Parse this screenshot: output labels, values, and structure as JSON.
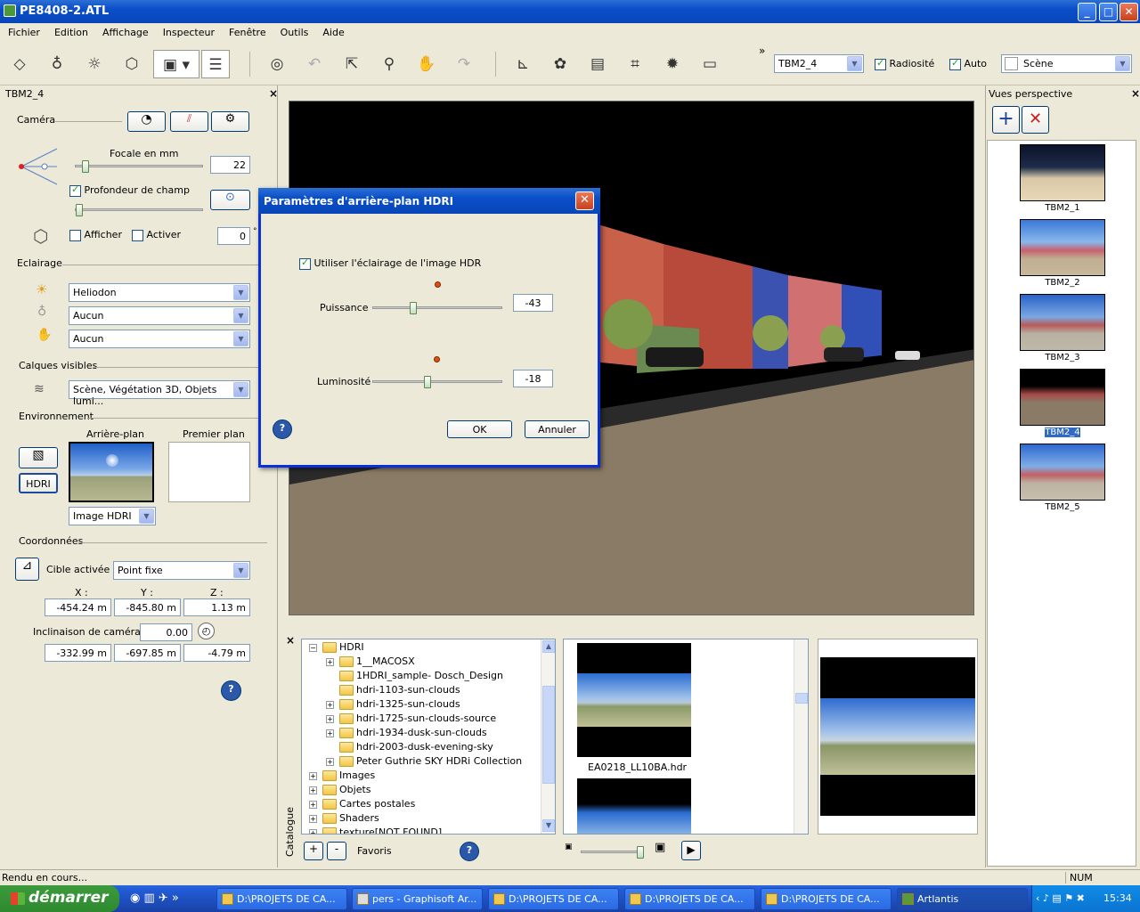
{
  "window": {
    "title": "PE8408-2.ATL"
  },
  "menu": [
    "Fichier",
    "Edition",
    "Affichage",
    "Inspecteur",
    "Fenêtre",
    "Outils",
    "Aide"
  ],
  "toolbar": {
    "view_select": "TBM2_4",
    "radiosity_label": "Radiosité",
    "auto_label": "Auto",
    "scene_select": "Scène",
    "overflow": "»"
  },
  "left_panel": {
    "title": "TBM2_4",
    "camera_label": "Caméra",
    "focal_label": "Focale en mm",
    "focal_value": "22",
    "focal_level": 0.05,
    "dof_label": "Profondeur de champ",
    "dof_level": 0.0,
    "show_label": "Afficher",
    "activate_label": "Activer",
    "angle_value": "0",
    "angle_unit": "°",
    "lighting_label": "Eclairage",
    "light1": "Heliodon",
    "light2": "Aucun",
    "light3": "Aucun",
    "layers_label": "Calques visibles",
    "layers_value": "Scène, Végétation 3D, Objets lumi...",
    "env_label": "Environnement",
    "background_label": "Arrière-plan",
    "foreground_label": "Premier plan",
    "hdri_button": "HDRI",
    "bg_type": "Image HDRI",
    "coords_label": "Coordonnées",
    "target_label": "Cible activée :",
    "target_value": "Point fixe",
    "x_label": "X :",
    "y_label": "Y :",
    "z_label": "Z :",
    "x1": "-454.24 m",
    "y1": "-845.80 m",
    "z1": "1.13 m",
    "tilt_label": "Inclinaison de caméra :",
    "tilt_value": "0.00",
    "x2": "-332.99 m",
    "y2": "-697.85 m",
    "z2": "-4.79 m",
    "help": "?"
  },
  "right_panel": {
    "title": "Vues perspective",
    "views": [
      "TBM2_1",
      "TBM2_2",
      "TBM2_3",
      "TBM2_4",
      "TBM2_5"
    ],
    "selected": "TBM2_4"
  },
  "dialog": {
    "title": "Paramètres d'arrière-plan HDRI",
    "use_hdr_label": "Utiliser l'éclairage de l'image HDR",
    "power_label": "Puissance",
    "power_value": "-43",
    "power_level": 0.3,
    "brightness_label": "Luminosité",
    "brightness_value": "-18",
    "brightness_level": 0.41,
    "ok_label": "OK",
    "cancel_label": "Annuler",
    "help": "?"
  },
  "catalog": {
    "side_label": "Catalogue",
    "tree": [
      {
        "label": "HDRI",
        "level": 0,
        "pm": "−"
      },
      {
        "label": "1__MACOSX",
        "level": 1,
        "pm": "+"
      },
      {
        "label": "1HDRI_sample- Dosch_Design",
        "level": 1,
        "pm": ""
      },
      {
        "label": "hdri-1103-sun-clouds",
        "level": 1,
        "pm": ""
      },
      {
        "label": "hdri-1325-sun-clouds",
        "level": 1,
        "pm": "+"
      },
      {
        "label": "hdri-1725-sun-clouds-source",
        "level": 1,
        "pm": "+"
      },
      {
        "label": "hdri-1934-dusk-sun-clouds",
        "level": 1,
        "pm": "+"
      },
      {
        "label": "hdri-2003-dusk-evening-sky",
        "level": 1,
        "pm": ""
      },
      {
        "label": "Peter Guthrie SKY HDRi Collection",
        "level": 1,
        "pm": "+"
      },
      {
        "label": "Images",
        "level": 0,
        "pm": "+"
      },
      {
        "label": "Objets",
        "level": 0,
        "pm": "+"
      },
      {
        "label": "Cartes postales",
        "level": 0,
        "pm": "+"
      },
      {
        "label": "Shaders",
        "level": 0,
        "pm": "+"
      },
      {
        "label": "texture[NOT FOUND]",
        "level": 0,
        "pm": "+"
      }
    ],
    "file_name": "EA0218_LL10BA.hdr",
    "add": "+",
    "remove": "-",
    "favorites": "Favoris",
    "help": "?"
  },
  "status": {
    "text": "Rendu en cours...",
    "num": "NUM"
  },
  "taskbar": {
    "start": "démarrer",
    "tasks": [
      "D:\\PROJETS DE CA...",
      "pers - Graphisoft Ar...",
      "D:\\PROJETS DE CA...",
      "D:\\PROJETS DE CA...",
      "D:\\PROJETS DE CA...",
      "Artlantis"
    ],
    "clock": "15:34"
  }
}
